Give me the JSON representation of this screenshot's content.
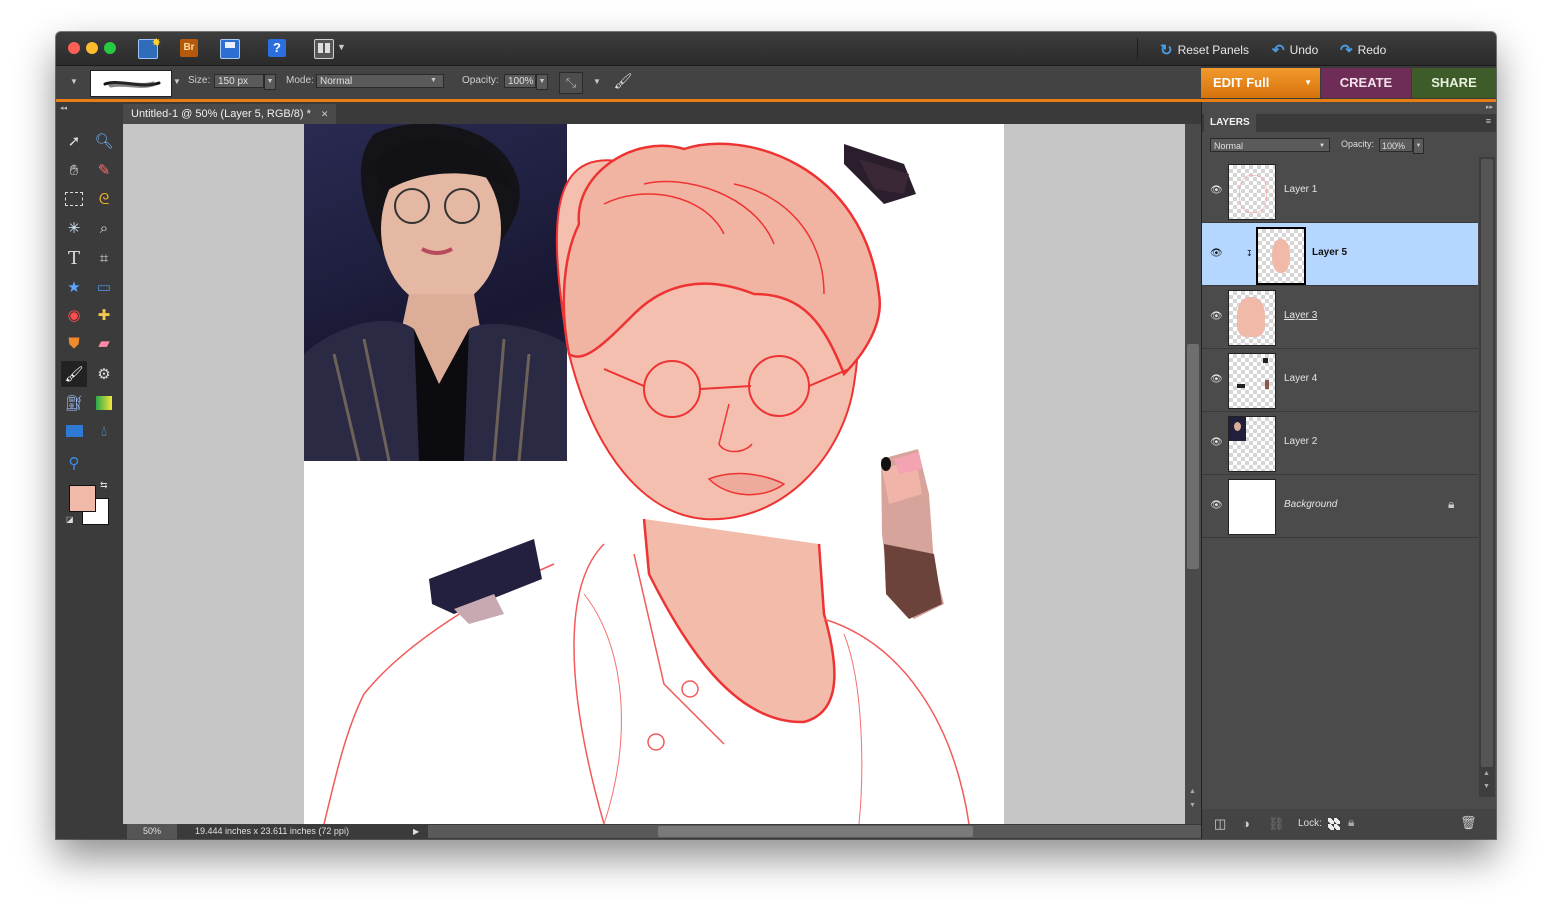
{
  "toolbar": {
    "reset_panels": "Reset Panels",
    "undo": "Undo",
    "redo": "Redo",
    "bridge_label": "Br",
    "help_label": "?"
  },
  "options": {
    "size_label": "Size:",
    "size_value": "150 px",
    "mode_label": "Mode:",
    "mode_value": "Normal",
    "opacity_label": "Opacity:",
    "opacity_value": "100%"
  },
  "mode_tabs": {
    "edit": "EDIT Full",
    "create": "CREATE",
    "share": "SHARE"
  },
  "document": {
    "tab_title": "Untitled-1 @ 50% (Layer 5, RGB/8) *",
    "close_glyph": "✕",
    "zoom": "50%",
    "dimensions": "19.444 inches x 23.611 inches (72 ppi)"
  },
  "colors": {
    "foreground": "#f0b9a8",
    "background": "#ffffff",
    "accent": "#e87d14",
    "selected_layer": "#b5d6ff",
    "sketch_line": "#ee3333",
    "skin_fill": "#f4bfae"
  },
  "layers_panel": {
    "title": "LAYERS",
    "blend_mode": "Normal",
    "opacity_label": "Opacity:",
    "opacity_value": "100%",
    "layers": [
      {
        "name": "Layer 1",
        "selected": false
      },
      {
        "name": "Layer 5",
        "selected": true
      },
      {
        "name": "Layer 3",
        "selected": false
      },
      {
        "name": "Layer 4",
        "selected": false
      },
      {
        "name": "Layer 2",
        "selected": false
      },
      {
        "name": "Background",
        "selected": false
      }
    ],
    "lock_label": "Lock:"
  },
  "icons": {
    "undo": "undo-icon",
    "redo": "redo-icon",
    "reset": "reset-panels-icon",
    "eye": "visibility-eye-icon",
    "lock": "lock-icon",
    "trash": "trash-icon"
  }
}
